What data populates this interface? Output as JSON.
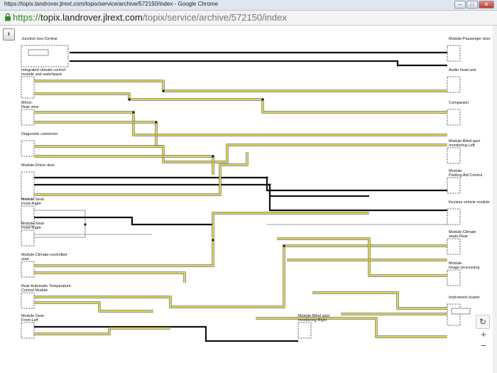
{
  "window": {
    "title": "https://topix.landrover.jlrext.com/topix/service/archive/572150/index - Google Chrome",
    "min": "–",
    "max": "□",
    "close": "✕"
  },
  "address": {
    "scheme": "https://",
    "host": "topix.landrover.jlrext.com",
    "path": "/topix/service/archive/572150/index"
  },
  "toolbar": {
    "expand_icon": "›"
  },
  "zoom": {
    "refresh": "↻",
    "in": "+",
    "out": "−"
  },
  "modules": [
    {
      "id": "jb",
      "label": "Junction box-Central",
      "l1": "Junction box-Central"
    },
    {
      "id": "icc",
      "label": "Integrated climate control module and switchpack",
      "l1": "Integrated climate control-",
      "l2": "module and switchpack"
    },
    {
      "id": "mirror",
      "label": "Mirror-Rear view",
      "l1": "Mirror-",
      "l2": "Rear view"
    },
    {
      "id": "diag",
      "label": "Diagnostic connector",
      "l1": "Diagnostic connector"
    },
    {
      "id": "ddoor",
      "label": "Module-Driver door",
      "l1": "Module-Driver door"
    },
    {
      "id": "seatfr1",
      "label": "Module-Seat-Front-Right",
      "l1": "Module-Seat-",
      "l2": "Front-Right"
    },
    {
      "id": "seatfr2",
      "label": "Module-Seat-Front-Right",
      "l1": "Module-Seat-",
      "l2": "Front-Right"
    },
    {
      "id": "ccseat",
      "label": "Module-Climate-controlled seat",
      "l1": "Module-Climate-controlled",
      "l2": "seat"
    },
    {
      "id": "ratc",
      "label": "Rear Automatic Temperature Control Module",
      "l1": "Rear Automatic Temperature",
      "l2": "Control Module"
    },
    {
      "id": "seatfl",
      "label": "Module-Seat-Front-Left",
      "l1": "Module-Seat-",
      "l2": "Front-Left"
    },
    {
      "id": "bsr",
      "label": "Module-Blind spot monitoring-Right",
      "l1": "Module-Blind spot",
      "l2": "monitoring-Right"
    },
    {
      "id": "pdoor",
      "label": "Module-Passenger door",
      "l1": "Module-Passenger door"
    },
    {
      "id": "audio",
      "label": "Audio head unit",
      "l1": "Audio head unit"
    },
    {
      "id": "companion",
      "label": "Companion",
      "l1": "Companion"
    },
    {
      "id": "bsl",
      "label": "Module-Blind spot monitoring-Left",
      "l1": "Module-Blind spot",
      "l2": "monitoring-Left"
    },
    {
      "id": "park",
      "label": "Module-Parking Aid Control",
      "l1": "Module-",
      "l2": "Parking Aid Control"
    },
    {
      "id": "keyless",
      "label": "Keyless vehicle module",
      "l1": "Keyless vehicle module"
    },
    {
      "id": "ccrear",
      "label": "Module-Climate seats-Rear",
      "l1": "Module-Climate",
      "l2": "seats-Rear"
    },
    {
      "id": "image",
      "label": "Module-Image processing",
      "l1": "Module-",
      "l2": "Image processing"
    },
    {
      "id": "cluster",
      "label": "Instrument cluster",
      "l1": "Instrument cluster"
    }
  ]
}
